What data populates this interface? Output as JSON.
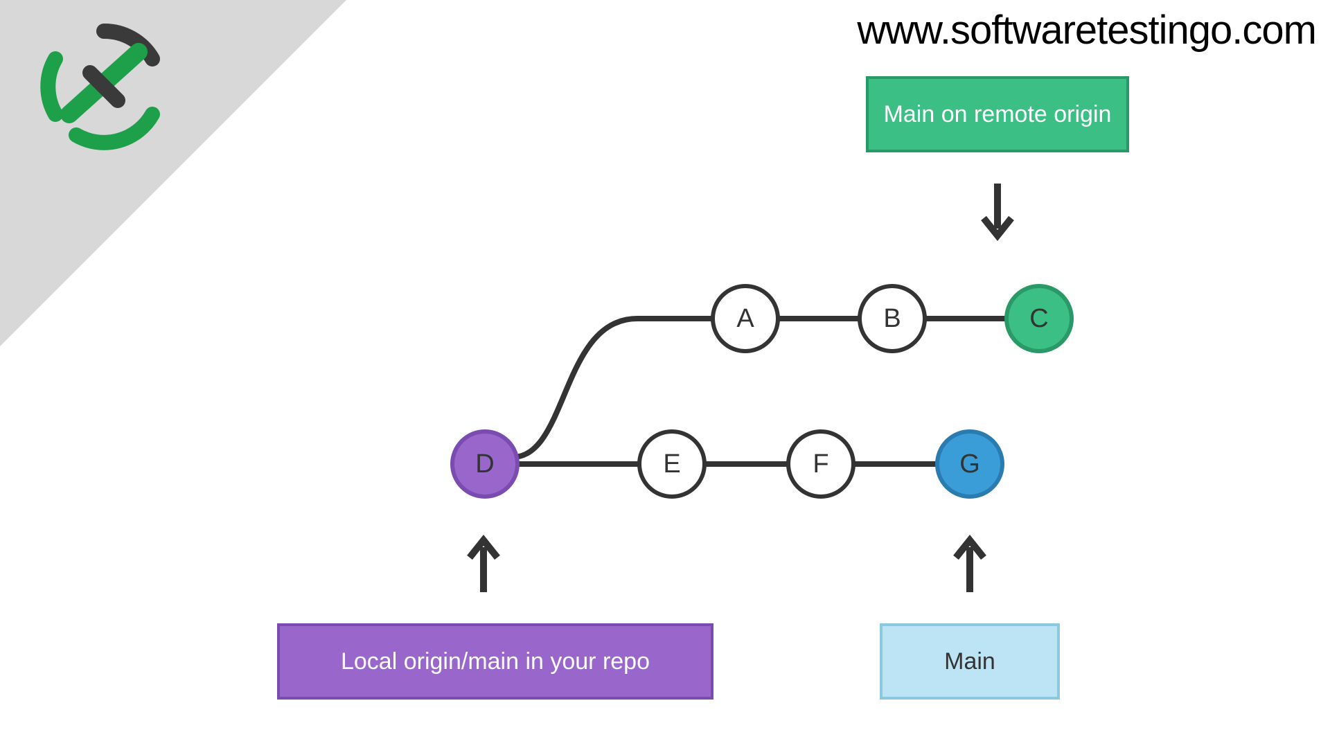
{
  "site_url": "www.softwaretestingo.com",
  "labels": {
    "remote": "Main on remote origin",
    "local": "Local origin/main in your repo",
    "main": "Main"
  },
  "nodes": {
    "a": "A",
    "b": "B",
    "c": "C",
    "d": "D",
    "e": "E",
    "f": "F",
    "g": "G"
  },
  "colors": {
    "remote_green": "#3bbf84",
    "local_purple": "#9966cc",
    "main_blue": "#3b9dd8",
    "main_light": "#bde4f4",
    "gray_bg": "#d8d8d8",
    "stroke": "#333333"
  }
}
